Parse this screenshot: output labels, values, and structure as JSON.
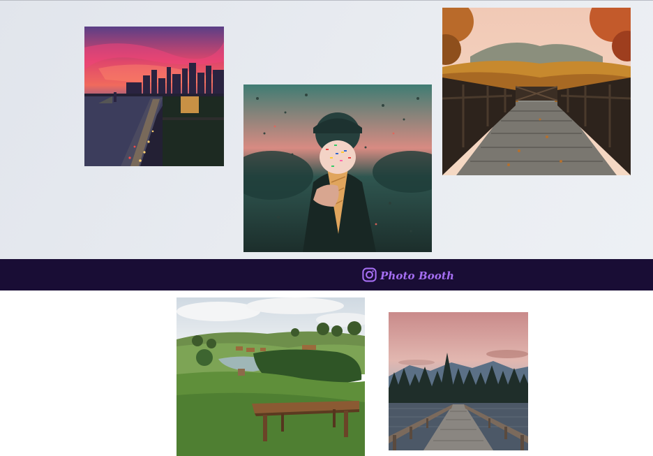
{
  "navbar": {
    "brand_label": "Photo Booth",
    "brand_icon": "instagram-icon",
    "brand_color": "#a56ef2",
    "background_color": "#190d35"
  },
  "gallery": {
    "photos": [
      {
        "name": "photo-city-sunset-skyline"
      },
      {
        "name": "photo-ice-cream-confetti"
      },
      {
        "name": "photo-wooden-bridge-autumn"
      },
      {
        "name": "photo-hillside-bench-lake"
      },
      {
        "name": "photo-pier-mountain-dusk"
      }
    ]
  }
}
